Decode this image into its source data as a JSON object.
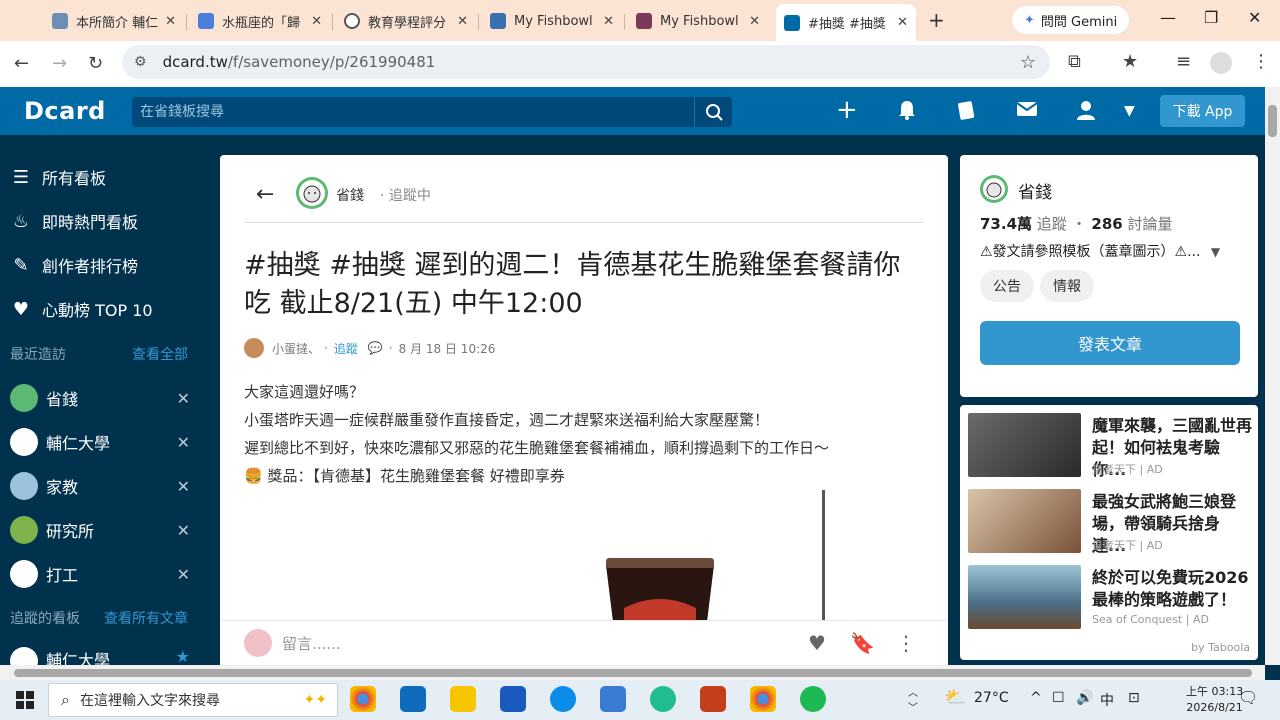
{
  "browser": {
    "tabs": [
      {
        "title": "本所簡介 輔仁",
        "color": "#6c8fb5"
      },
      {
        "title": "水瓶座的「歸",
        "color": "#4a7fdc"
      },
      {
        "title": "教育學程評分",
        "color": "#555555"
      },
      {
        "title": "My Fishbowl",
        "color": "#3a6fb4"
      },
      {
        "title": "My Fishbowl",
        "color": "#7a3a5a"
      },
      {
        "title": "#抽獎 #抽獎",
        "color": "#006aa6"
      }
    ],
    "gemini_label": "問問 Gemini",
    "url_host": "dcard.tw",
    "url_path": "/f/savemoney/p/261990481"
  },
  "header": {
    "logo": "Dcard",
    "search_placeholder": "在省錢板搜尋",
    "download_label": "下載 App"
  },
  "sidebar": {
    "items": [
      {
        "label": "所有看板",
        "icon": "list-icon"
      },
      {
        "label": "即時熱門看板",
        "icon": "fire-icon"
      },
      {
        "label": "創作者排行榜",
        "icon": "compass-icon"
      },
      {
        "label": "心動榜 TOP 10",
        "icon": "heart-icon"
      }
    ],
    "recent_title": "最近造訪",
    "recent_link": "查看全部",
    "recent": [
      {
        "label": "省錢",
        "color": "#5bb974"
      },
      {
        "label": "輔仁大學",
        "color": "#ffffff"
      },
      {
        "label": "家教",
        "color": "#9cc3dc"
      },
      {
        "label": "研究所",
        "color": "#7fb24a"
      },
      {
        "label": "打工",
        "color": "#ffffff"
      }
    ],
    "following_title": "追蹤的看板",
    "following_link": "查看所有文章",
    "following_partial": "輔仁大學"
  },
  "post": {
    "forum": "省錢",
    "forum_status": "· 追蹤中",
    "title": "#抽獎 #抽獎 遲到的週二！肯德基花生脆雞堡套餐請你吃 截止8/21(五) 中午12:00",
    "author": "小蛋撻、",
    "dot": "·",
    "follow": "追蹤",
    "time": "8 月 18 日 10:26",
    "body": [
      "大家這週還好嗎？",
      "小蛋塔昨天週一症候群嚴重發作直接昏定，週二才趕緊來送福利給大家壓壓驚！",
      "遲到總比不到好，快來吃濃郁又邪惡的花生脆雞堡套餐補補血，順利撐過剩下的工作日～",
      "🍔 獎品：【肯德基】花生脆雞堡套餐 好禮即享券"
    ],
    "comment_placeholder": "留言......"
  },
  "forum_card": {
    "name": "省錢",
    "followers": "73.4萬",
    "followers_label": "追蹤",
    "sep": "・",
    "posts": "286",
    "posts_label": "討論量",
    "note": "⚠發文請參照模板（蓋章圖示）⚠...",
    "tags": [
      "公告",
      "情報"
    ],
    "post_button": "發表文章"
  },
  "ads": {
    "items": [
      {
        "title": "魔軍來襲，三國亂世再起！如何袪鬼考驗你...",
        "source": "皇者天下",
        "tag": "AD"
      },
      {
        "title": "最強女武將鮑三娘登場，帶領騎兵捨身連...",
        "source": "皇者天下",
        "tag": "AD"
      },
      {
        "title": "終於可以免費玩2026最棒的策略遊戲了！",
        "source": "Sea of Conquest",
        "tag": "AD"
      }
    ],
    "sep": "|",
    "provider": "by Taboola"
  },
  "taskbar": {
    "search_placeholder": "在這裡輸入文字來搜尋",
    "temperature": "27°C",
    "ime": "中",
    "time": "上午 03:13",
    "date": "2026/8/21"
  }
}
